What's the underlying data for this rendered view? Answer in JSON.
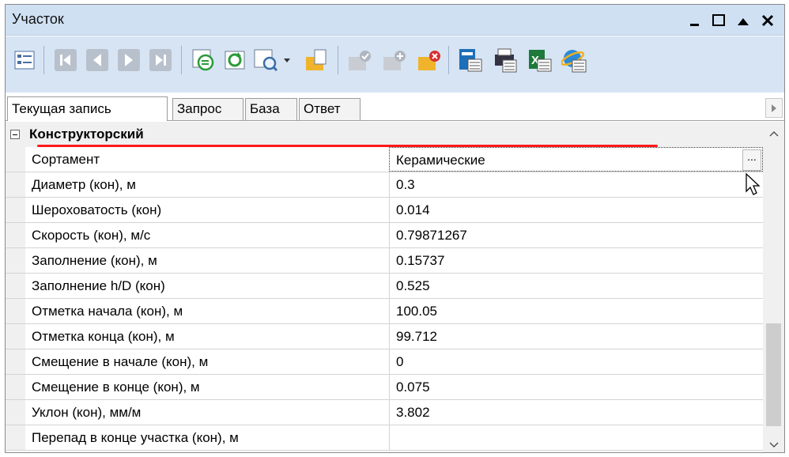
{
  "window": {
    "title": "Участок",
    "controls": [
      "minimize-icon",
      "maximize-icon",
      "restore-up-icon",
      "close-icon"
    ]
  },
  "toolbar": {
    "buttons": [
      "properties-icon",
      "first-record-icon",
      "prev-record-icon",
      "next-record-icon",
      "last-record-icon",
      "sync-icon",
      "refresh-icon",
      "zoom-to-object-icon",
      "new-record-icon",
      "apply-record-icon",
      "add-record-icon",
      "delete-record-icon",
      "print-preview-icon",
      "print-icon",
      "excel-export-icon",
      "web-icon"
    ]
  },
  "tabs": [
    "Текущая запись",
    "Запрос",
    "База",
    "Ответ"
  ],
  "active_tab": "Текущая запись",
  "category": {
    "label": "Конструкторский",
    "rows": [
      {
        "name": "Сортамент",
        "value": "Керамические",
        "selected": true
      },
      {
        "name": "Диаметр (кон), м",
        "value": "0.3"
      },
      {
        "name": "Шероховатость (кон)",
        "value": "0.014"
      },
      {
        "name": "Скорость (кон), м/с",
        "value": "0.79871267"
      },
      {
        "name": "Заполнение (кон), м",
        "value": "0.15737"
      },
      {
        "name": "Заполнение h/D (кон)",
        "value": "0.525"
      },
      {
        "name": "Отметка начала (кон), м",
        "value": "100.05"
      },
      {
        "name": "Отметка конца (кон), м",
        "value": "99.712"
      },
      {
        "name": "Смещение в начале (кон), м",
        "value": "0"
      },
      {
        "name": "Смещение в конце (кон), м",
        "value": "0.075"
      },
      {
        "name": "Уклон (кон), мм/м",
        "value": "3.802"
      },
      {
        "name": "Перепад в конце участка (кон), м",
        "value": ""
      }
    ]
  },
  "ellipsis_label": "...",
  "colors": {
    "title_bar": "#cfe0f3",
    "toolbar": "#d6e4f4",
    "highlight_line": "#ff1a1a"
  }
}
